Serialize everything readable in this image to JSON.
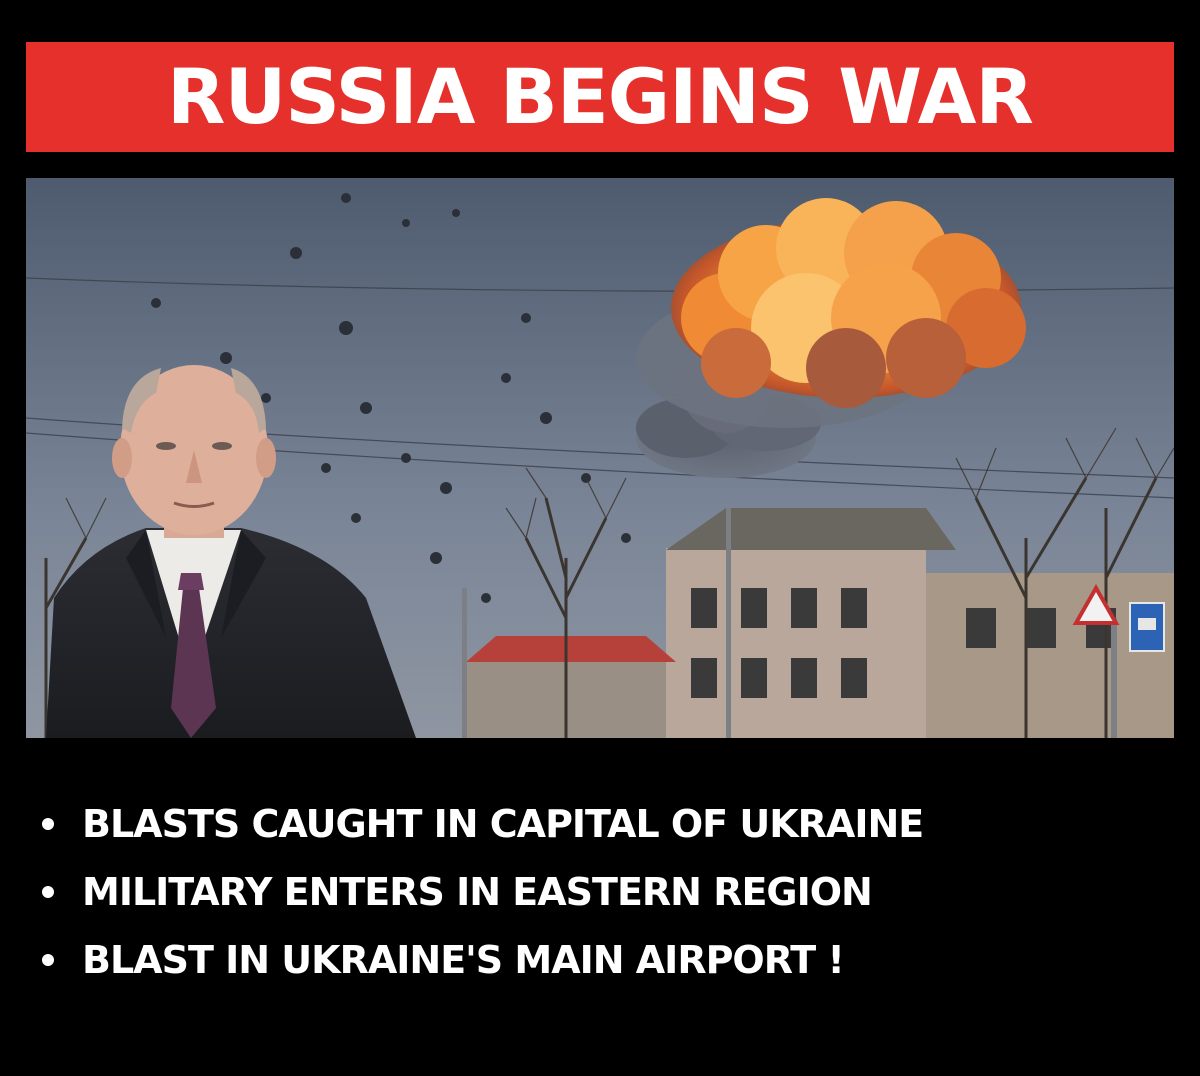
{
  "banner": {
    "title": "RUSSIA BEGINS WAR",
    "background_color": "#e5302c",
    "text_color": "#ffffff"
  },
  "photo": {
    "content": "man-in-suit-speaking-over-explosion-cloud"
  },
  "bullets": [
    {
      "text": "BLASTS CAUGHT IN CAPITAL OF UKRAINE"
    },
    {
      "text": "MILITARY ENTERS IN EASTERN REGION"
    },
    {
      "text": "BLAST IN UKRAINE'S MAIN AIRPORT !"
    }
  ],
  "colors": {
    "page_background": "#000000",
    "bullet_text": "#ffffff",
    "explosion": "#f28a2c"
  }
}
